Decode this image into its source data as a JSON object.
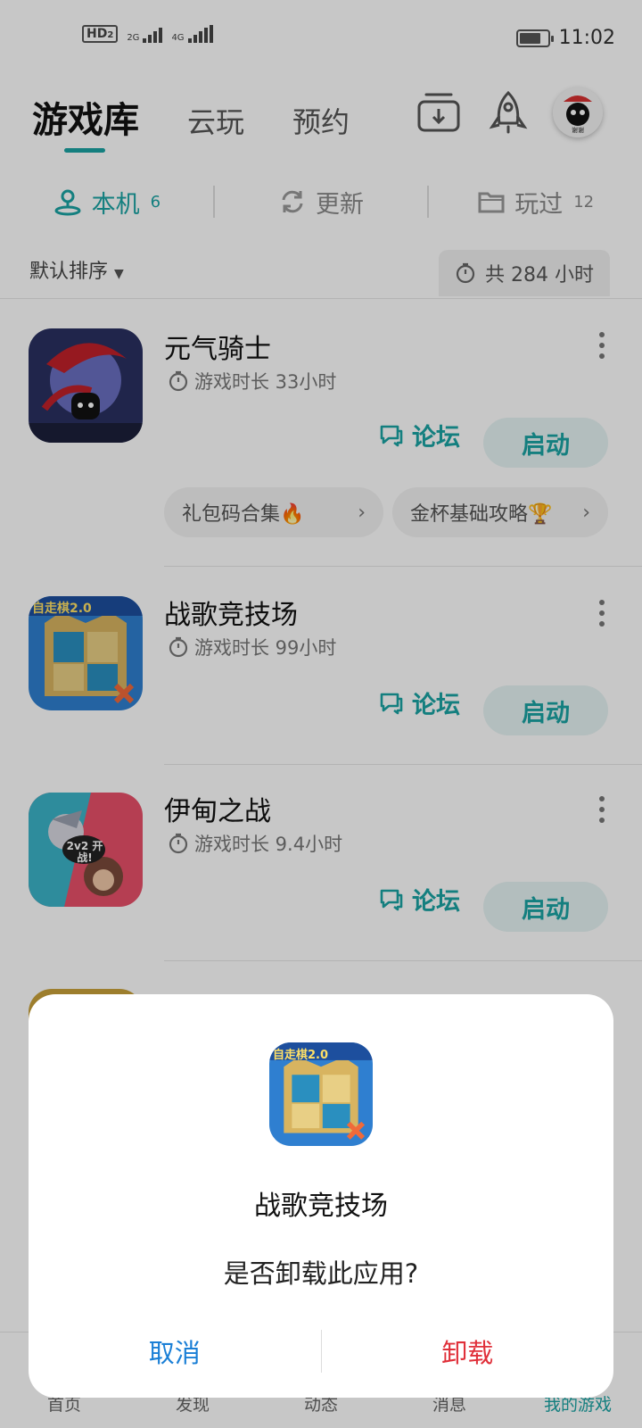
{
  "status_bar": {
    "hd_label": "HD",
    "hd_sub": "2",
    "net1": "2G",
    "net2": "4G",
    "battery_level": 0.75,
    "time": "11:02"
  },
  "header": {
    "tabs": [
      {
        "label": "游戏库",
        "active": true
      },
      {
        "label": "云玩",
        "active": false
      },
      {
        "label": "预约",
        "active": false
      }
    ],
    "download_icon": "download-tray-icon",
    "boost_icon": "rocket-icon",
    "avatar_caption": "谢谢"
  },
  "subtabs": [
    {
      "label": "本机",
      "count": "6",
      "icon": "location-pin-icon",
      "active": true
    },
    {
      "label": "更新",
      "count": "",
      "icon": "refresh-icon",
      "active": false
    },
    {
      "label": "玩过",
      "count": "12",
      "icon": "folder-icon",
      "active": false
    }
  ],
  "sort": {
    "label": "默认排序",
    "total_playtime": "共 284 小时"
  },
  "games": [
    {
      "name": "元气骑士",
      "playtime": "游戏时长 33小时",
      "forum": "论坛",
      "launch": "启动",
      "chips": [
        "礼包码合集🔥",
        "金杯基础攻略🏆"
      ]
    },
    {
      "name": "战歌竞技场",
      "playtime": "游戏时长 99小时",
      "forum": "论坛",
      "launch": "启动",
      "icon_badge": "自走棋2.0"
    },
    {
      "name": "伊甸之战",
      "playtime": "游戏时长 9.4小时",
      "forum": "论坛",
      "launch": "启动",
      "icon_badge": "2v2 开战!"
    }
  ],
  "bottom_nav": [
    {
      "label": "首页",
      "active": false
    },
    {
      "label": "发现",
      "active": false
    },
    {
      "label": "动态",
      "active": false
    },
    {
      "label": "消息",
      "active": false
    },
    {
      "label": "我的游戏",
      "active": true
    }
  ],
  "dialog": {
    "app_name": "战歌竞技场",
    "icon_badge": "自走棋2.0",
    "message": "是否卸载此应用?",
    "cancel": "取消",
    "confirm": "卸载"
  },
  "colors": {
    "accent": "#1aa3a3",
    "cancel_blue": "#1a7fd6",
    "danger_red": "#e0303a"
  }
}
